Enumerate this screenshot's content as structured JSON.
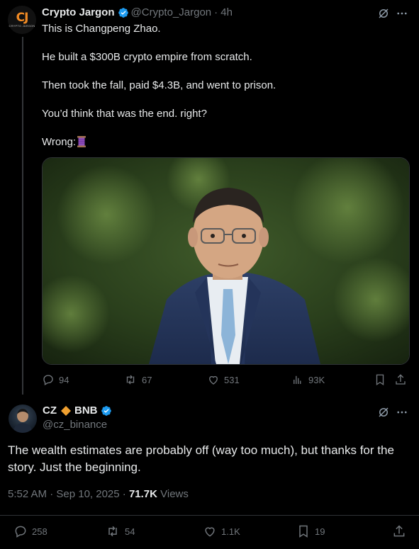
{
  "quoted_tweet": {
    "author_name": "Crypto Jargon",
    "author_handle": "@Crypto_Jargon",
    "time_ago": "· 4h",
    "avatar_text": "CJ",
    "avatar_subtext": "CRYPTO JARGON",
    "paragraphs": [
      "This is Changpeng Zhao.",
      "He built a $300B crypto empire from scratch.",
      "Then took the fall, paid $4.3B, and went to prison.",
      "You’d think that was the end. right?",
      "Wrong:"
    ],
    "emoji": "spool-of-thread-emoji",
    "actions": {
      "replies": "94",
      "reposts": "67",
      "likes": "531",
      "views": "93K"
    }
  },
  "reply_tweet": {
    "author_name": "CZ",
    "author_name_suffix": "BNB",
    "author_handle": "@cz_binance",
    "text": "The wealth estimates are probably off (way too much), but thanks for the story. Just the beginning.",
    "timestamp": "5:52 AM · Sep 10, 2025 · ",
    "views_count": "71.7K",
    "views_label": " Views",
    "actions": {
      "replies": "258",
      "reposts": "54",
      "likes": "1.1K",
      "bookmarks": "19"
    }
  },
  "colors": {
    "background": "#000000",
    "text": "#e7e9ea",
    "muted": "#71767b",
    "verified": "#1d9bf0",
    "bnb_diamond": "#f0a030",
    "brand_orange": "#f08a24"
  }
}
